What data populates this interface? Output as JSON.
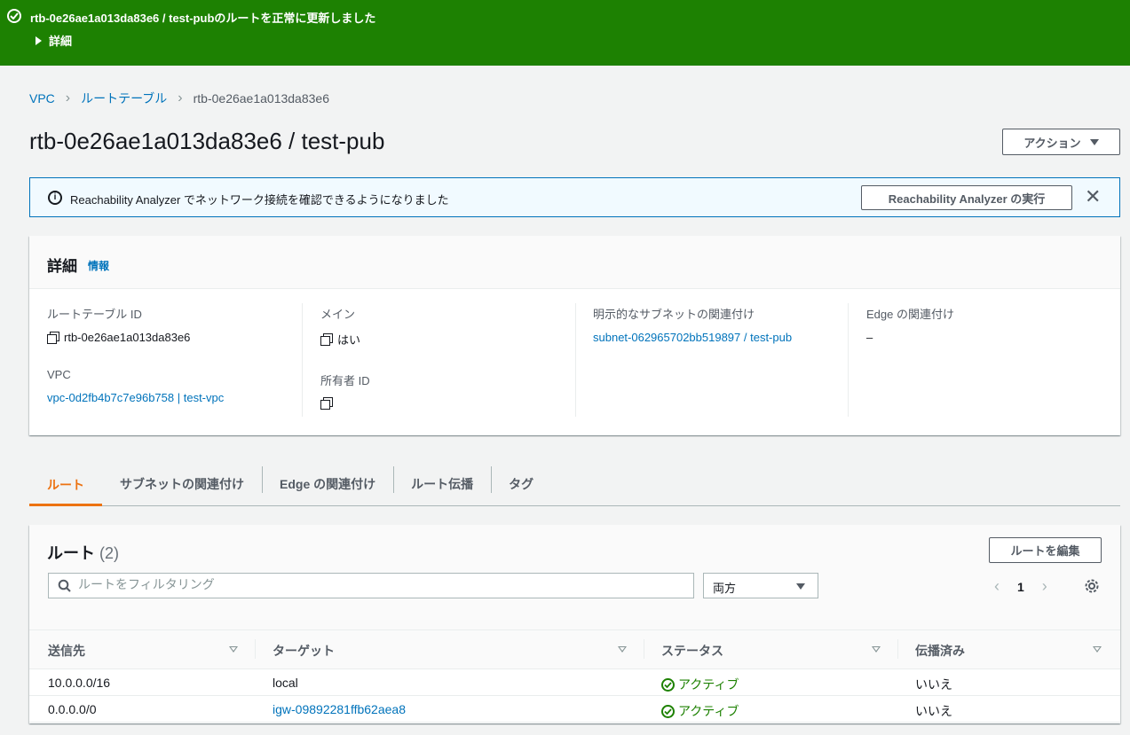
{
  "flash": {
    "message": "rtb-0e26ae1a013da83e6 / test-pubのルートを正常に更新しました",
    "details_label": "詳細"
  },
  "breadcrumb": [
    "VPC",
    "ルートテーブル",
    "rtb-0e26ae1a013da83e6"
  ],
  "page": {
    "title": "rtb-0e26ae1a013da83e6 / test-pub",
    "actions_label": "アクション"
  },
  "info_banner": {
    "text": "Reachability Analyzer でネットワーク接続を確認できるようになりました",
    "button_label": "Reachability Analyzer の実行"
  },
  "details": {
    "title": "詳細",
    "info_link": "情報",
    "route_table_id_label": "ルートテーブル ID",
    "route_table_id": "rtb-0e26ae1a013da83e6",
    "vpc_label": "VPC",
    "vpc_value": "vpc-0d2fb4b7c7e96b758 | test-vpc",
    "main_label": "メイン",
    "main_value": "はい",
    "owner_label": "所有者 ID",
    "owner_value": "",
    "subnet_assoc_label": "明示的なサブネットの関連付け",
    "subnet_assoc_value": "subnet-062965702bb519897 / test-pub",
    "edge_assoc_label": "Edge の関連付け",
    "edge_assoc_value": "–"
  },
  "tabs": [
    "ルート",
    "サブネットの関連付け",
    "Edge の関連付け",
    "ルート伝播",
    "タグ"
  ],
  "routes": {
    "title": "ルート",
    "count": "(2)",
    "edit_label": "ルートを編集",
    "search_placeholder": "ルートをフィルタリング",
    "filter_value": "両方",
    "page_number": "1",
    "columns": [
      "送信先",
      "ターゲット",
      "ステータス",
      "伝播済み"
    ],
    "rows": [
      {
        "destination": "10.0.0.0/16",
        "target": "local",
        "status": "アクティブ",
        "propagated": "いいえ"
      },
      {
        "destination": "0.0.0.0/0",
        "target": "igw-09892281ffb62aea8",
        "status": "アクティブ",
        "propagated": "いいえ"
      }
    ]
  },
  "colors": {
    "success": "#1d8102",
    "link": "#0073bb",
    "active_tab": "#ec7211",
    "info_bg": "#f1faff"
  }
}
